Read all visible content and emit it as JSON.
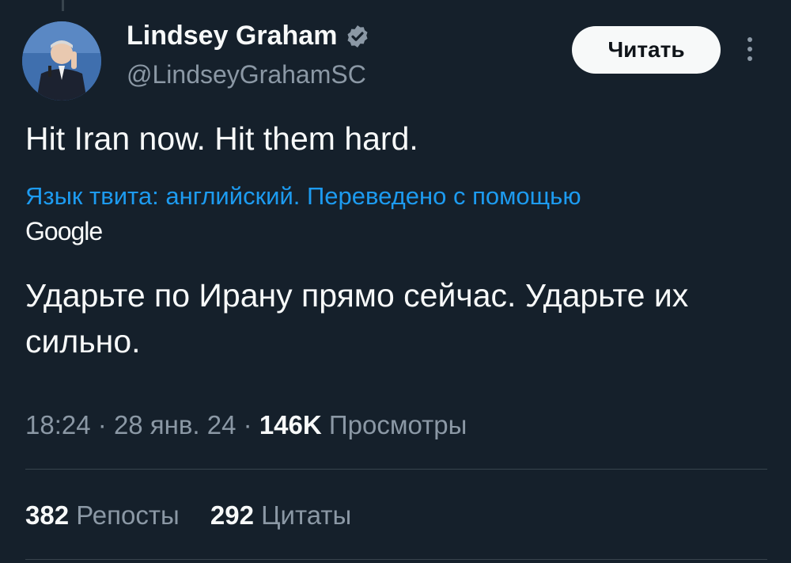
{
  "tweet": {
    "author_name": "Lindsey Graham",
    "author_handle": "@LindseyGrahamSC",
    "follow_label": "Читать",
    "text": "Hit Iran now. Hit them hard.",
    "translation_note": "Язык твита: английский. Переведено с помощью",
    "translation_provider": "Google",
    "translated_text": "Ударьте по Ирану прямо сейчас. Ударьте их сильно.",
    "time": "18:24",
    "separator": "·",
    "date": "28 янв. 24",
    "views_count": "146K",
    "views_label": "Просмотры",
    "reposts_count": "382",
    "reposts_label": "Репосты",
    "quotes_count": "292",
    "quotes_label": "Цитаты"
  },
  "icons": {
    "verified": "verified-badge-icon",
    "more": "more-vertical-icon"
  },
  "colors": {
    "background": "#15202b",
    "text_primary": "#f7f9f9",
    "text_secondary": "#8b98a5",
    "link": "#1d9bf0",
    "divider": "#38444d",
    "button_bg": "#f7f9f9",
    "button_text": "#0f1419"
  }
}
